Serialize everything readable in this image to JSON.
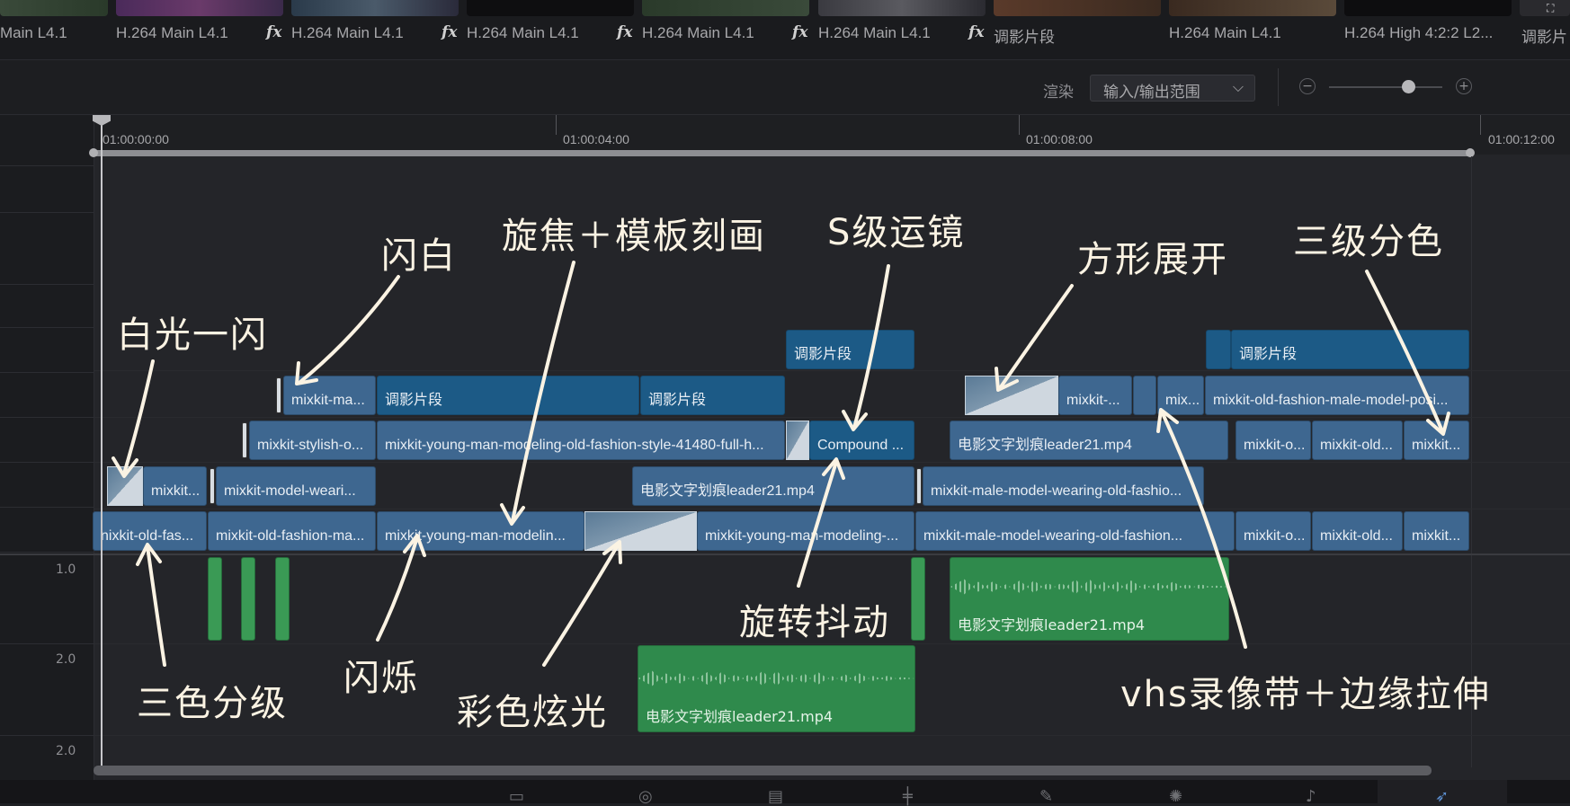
{
  "media_strip": {
    "items": [
      {
        "label": "Main L4.1",
        "fx": false
      },
      {
        "label": "H.264 Main L4.1",
        "fx": false
      },
      {
        "label": "H.264 Main L4.1",
        "fx": true
      },
      {
        "label": "H.264 Main L4.1",
        "fx": true
      },
      {
        "label": "H.264 Main L4.1",
        "fx": true
      },
      {
        "label": "H.264 Main L4.1",
        "fx": true
      },
      {
        "label": "调影片段",
        "fx": true
      },
      {
        "label": "H.264 Main L4.1",
        "fx": false
      },
      {
        "label": "H.264 High 4:2:2 L2...",
        "fx": false
      },
      {
        "label": "调影片",
        "fx": false
      }
    ],
    "fx_glyph": "fx"
  },
  "toolbar": {
    "render_label": "渲染",
    "range_dropdown": "输入/输出范围",
    "zoom_minus": "−",
    "zoom_plus": "+",
    "zoom_level": 0.7
  },
  "ruler": {
    "timecodes": [
      "01:00:00:00",
      "01:00:04:00",
      "01:00:08:00",
      "01:00:12:00"
    ]
  },
  "track_headers": {
    "volumes": [
      "1.0",
      "2.0",
      "2.0"
    ]
  },
  "clips": {
    "v6": [
      {
        "label": "调影片段"
      },
      {
        "label": ""
      },
      {
        "label": "调影片段"
      }
    ],
    "v5": [
      {
        "label": "mixkit-ma..."
      },
      {
        "label": "调影片段"
      },
      {
        "label": "调影片段"
      },
      {
        "label": "mixkit-..."
      },
      {
        "label": ""
      },
      {
        "label": "mix..."
      },
      {
        "label": "mixkit-old-fashion-male-model-posi..."
      }
    ],
    "v4": [
      {
        "label": "mixkit-stylish-o..."
      },
      {
        "label": "mixkit-young-man-modeling-old-fashion-style-41480-full-h..."
      },
      {
        "label": "Compound ..."
      },
      {
        "label": "电影文字划痕leader21.mp4"
      },
      {
        "label": "mixkit-o..."
      },
      {
        "label": "mixkit-old..."
      },
      {
        "label": "mixkit..."
      }
    ],
    "v3": [
      {
        "label": "mixkit..."
      },
      {
        "label": "mixkit-model-weari..."
      },
      {
        "label": "电影文字划痕leader21.mp4"
      },
      {
        "label": "mixkit-male-model-wearing-old-fashio..."
      }
    ],
    "v2": [
      {
        "label": "nixkit-old-fas..."
      },
      {
        "label": "mixkit-old-fashion-ma..."
      },
      {
        "label": "mixkit-young-man-modelin..."
      },
      {
        "label": "mixkit-young-man-modeling-..."
      },
      {
        "label": "mixkit-male-model-wearing-old-fashion..."
      },
      {
        "label": "mixkit-o..."
      },
      {
        "label": "mixkit-old..."
      },
      {
        "label": "mixkit..."
      }
    ],
    "a1": [
      {
        "label": "电影文字划痕leader21.mp4"
      }
    ],
    "a2": [
      {
        "label": "电影文字划痕leader21.mp4"
      }
    ]
  },
  "annotations": {
    "bai_guang_yi_shan": "白光一闪",
    "shan_bai": "闪白",
    "xuan_jiao": "旋焦＋模板刻画",
    "s_ji_yun_jing": "S级运镜",
    "fang_xing_zhan_kai": "方形展开",
    "san_ji_fen_se": "三级分色",
    "san_se_fen_ji": "三色分级",
    "shan_shuo": "闪烁",
    "cai_se_xuan_guang": "彩色炫光",
    "xuan_zhuan_dou_dong": "旋转抖动",
    "vhs": "vhs录像带＋边缘拉伸"
  },
  "page_icons": [
    "media-icon",
    "cut-icon",
    "edit-icon",
    "fusion-icon",
    "color-icon",
    "fairlight-icon",
    "music-icon",
    "deliver-icon"
  ],
  "colors": {
    "video_clip": "#3e6790",
    "compound_clip": "#1c5a86",
    "audio_clip": "#2f8a4c",
    "annotation": "#fbf3e3"
  }
}
